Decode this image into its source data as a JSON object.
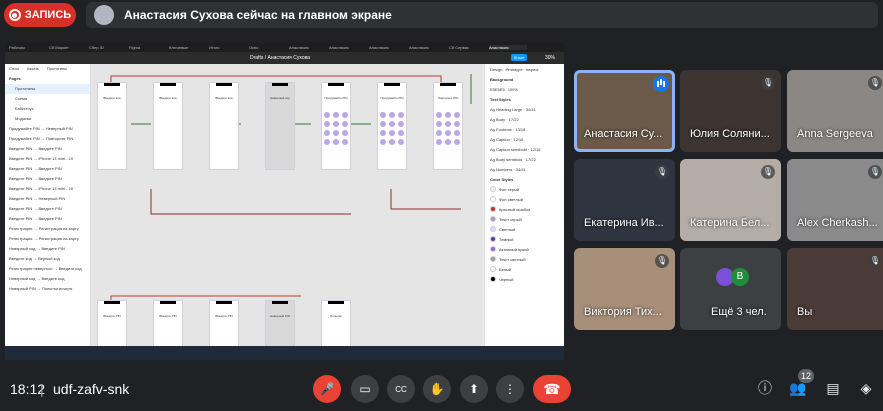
{
  "recording": {
    "label": "ЗАПИСЬ",
    "color": "#d93025"
  },
  "presenter": {
    "text": "Анастасия Сухова сейчас на главном экране"
  },
  "shared_screen": {
    "app": "Figma",
    "tabs": [
      "Рабочая",
      "Сб Маркет",
      "Сбер ID",
      "Figma",
      "Ключевые",
      "Итого",
      "Окно",
      "Анастасия",
      "Анастасия",
      "Анастасия",
      "Анастасия",
      "Сб Сервис",
      "Анастасия"
    ],
    "active_tab_index": 12,
    "breadcrumb": "Drafts / Анастасия Сухова",
    "share_label": "Share",
    "zoom": "30%",
    "left_panel": {
      "tabs": [
        "Слои",
        "Assets",
        "Прототипы"
      ],
      "pages_header": "Pages",
      "pages": [
        "Прототипы",
        "Схема",
        "Бэйкстоуз",
        "Модалки"
      ],
      "layers": [
        "Придумайте PIN → Неверный PIN",
        "Придумайте PIN → Повторите PIN",
        "Введите PIN → Введите PIN",
        "Введите PIN → iPhone 13 mini - 19",
        "Введите PIN → Введите PIN",
        "Введите PIN → Введите PIN",
        "Введите PIN → iPhone 13 mini - 18",
        "Введите PIN → Неверный PIN",
        "Введите PIN → Введите PIN",
        "Введите PIN → Введите PIN",
        "Регистрация → Регистрация на карту",
        "Регистрация → Регистрация на карту",
        "Неверный код → Введите PIN",
        "Введите код → Верный код",
        "Регистрация неверного → Введите код",
        "Неверный код → Введите код",
        "Неверный PIN → Попытки исчерп."
      ]
    },
    "right_panel": {
      "tabs": [
        "Design",
        "Prototype",
        "Inspect"
      ],
      "background_label": "Background",
      "background_value": "E5E5E5",
      "background_opacity": "100%",
      "text_styles_header": "Text Styles",
      "text_styles": [
        "Ag Heading Large · 34/41",
        "Ag Body · 17/22",
        "Ag Footnote · 13/18",
        "Ag Caption · 12/16",
        "Ag Caption semibold · 12/16",
        "Ag Body semibold · 17/22",
        "Ag Numbers · 34/41"
      ],
      "color_styles_header": "Color Styles",
      "color_styles": [
        {
          "name": "Фон серый",
          "color": "#f2f2f7"
        },
        {
          "name": "Фон светлый",
          "color": "#ffffff"
        },
        {
          "name": "Красный ошибка",
          "color": "#c0392b"
        },
        {
          "name": "Текст серый",
          "color": "#a59fb0"
        },
        {
          "name": "Светлый",
          "color": "#e5d8ff"
        },
        {
          "name": "Темный",
          "color": "#5b3fa8"
        },
        {
          "name": "Активный яркий",
          "color": "#8f6df0"
        },
        {
          "name": "Текст светлый",
          "color": "#9e9e9e"
        },
        {
          "name": "Белый",
          "color": "#ffffff"
        },
        {
          "name": "Черный",
          "color": "#000000"
        }
      ]
    },
    "frames": [
      {
        "title": "Введите код",
        "dim": false,
        "pad": false
      },
      {
        "title": "Введите код",
        "dim": false,
        "pad": false
      },
      {
        "title": "Введите код",
        "dim": false,
        "pad": false
      },
      {
        "title": "Неверный код",
        "dim": true,
        "pad": false
      },
      {
        "title": "Придумайте PIN",
        "dim": false,
        "pad": true
      },
      {
        "title": "Придумайте PIN",
        "dim": false,
        "pad": true
      },
      {
        "title": "Повторите PIN",
        "dim": false,
        "pad": true
      }
    ],
    "frames_row2": [
      {
        "title": "Введите PIN",
        "dim": false
      },
      {
        "title": "Введите PIN",
        "dim": false
      },
      {
        "title": "Введите PIN",
        "dim": false
      },
      {
        "title": "Неверный PIN",
        "dim": true
      },
      {
        "title": "Попытки",
        "dim": false
      }
    ]
  },
  "participants": [
    {
      "name": "Анастасия Су...",
      "speaking": true,
      "muted": false,
      "bg": "#6b5a4a"
    },
    {
      "name": "Юлия Соляни...",
      "speaking": false,
      "muted": true,
      "bg": "#3b3430"
    },
    {
      "name": "Anna Sergeeva",
      "speaking": false,
      "muted": true,
      "bg": "#8a8784"
    },
    {
      "name": "Екатерина Ив...",
      "speaking": false,
      "muted": true,
      "bg": "#2f3540"
    },
    {
      "name": "Катерина Бел...",
      "speaking": false,
      "muted": true,
      "bg": "#b4aca6"
    },
    {
      "name": "Alex Cherkash...",
      "speaking": false,
      "muted": true,
      "bg": "#8a8a8a"
    },
    {
      "name": "Виктория Тих...",
      "speaking": false,
      "muted": true,
      "bg": "#a88f7a"
    },
    {
      "name": "Ещё 3 чел.",
      "speaking": false,
      "muted": false,
      "bg": "#3c4043"
    },
    {
      "name": "Вы",
      "speaking": false,
      "muted": true,
      "bg": "#4a3b36"
    }
  ],
  "more_avatars": [
    {
      "letter": "",
      "color": "#7b4fd6"
    },
    {
      "letter": "В",
      "color": "#1e8e3e"
    }
  ],
  "bottom_bar": {
    "time": "18:12",
    "separator": "|",
    "meeting_code": "udf-zafv-snk",
    "participant_count": "12"
  },
  "icons": {
    "mic": "mic-off-icon",
    "cam": "camera-icon",
    "cc": "captions-icon",
    "hand": "raise-hand-icon",
    "present": "present-icon",
    "more": "more-vert-icon",
    "end": "end-call-icon",
    "info": "info-icon",
    "people": "people-icon",
    "chat": "chat-icon",
    "activities": "activities-icon"
  }
}
